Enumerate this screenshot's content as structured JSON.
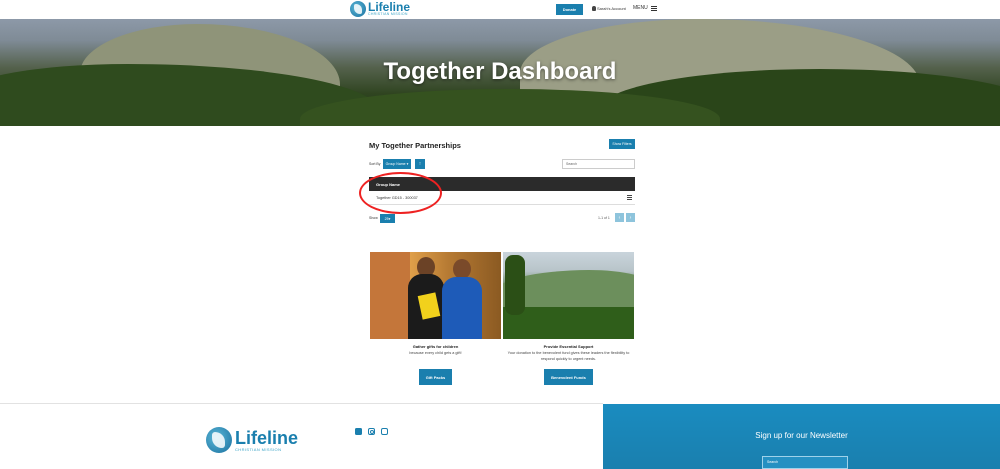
{
  "header": {
    "logo_name": "Lifeline",
    "logo_sub": "CHRISTIAN MISSION",
    "donate_label": "Donate",
    "account_label": "Sarah's Account",
    "menu_label": "MENU"
  },
  "hero": {
    "title": "Together Dashboard"
  },
  "partnerships": {
    "title": "My Together Partnerships",
    "show_filters_label": "Show Filters",
    "sort_by_label": "Sort By",
    "sort_select_value": "Group Name",
    "sort_direction": "↑",
    "search_placeholder": "Search",
    "column_header": "Group Name",
    "rows": [
      {
        "name": "Together GD15 - 300037"
      }
    ],
    "show_label": "Show",
    "page_size": "25",
    "pager_info": "1-1 of 1",
    "prev_label": "‹",
    "next_label": "›"
  },
  "cards": [
    {
      "title": "Gather gifts for children",
      "text": "because every child gets a gift!",
      "button_label": "Gift Packs"
    },
    {
      "title": "Provide Essential Support",
      "text": "Your donation to the benevolent fund gives these leaders the flexibility to respond quickly to urgent needs.",
      "button_label": "Benevolent Funds"
    }
  ],
  "footer": {
    "logo_name": "Lifeline",
    "logo_sub": "CHRISTIAN MISSION",
    "newsletter_title": "Sign up for our Newsletter",
    "newsletter_placeholder": "Search"
  },
  "colors": {
    "primary": "#1a7fae",
    "table_header": "#2b2b2b",
    "annotation": "#ee2222"
  },
  "icons": [
    "globe-logo-icon",
    "user-icon",
    "hamburger-icon",
    "chevron-down-icon",
    "row-menu-icon",
    "facebook-icon",
    "instagram-icon",
    "youtube-icon"
  ]
}
